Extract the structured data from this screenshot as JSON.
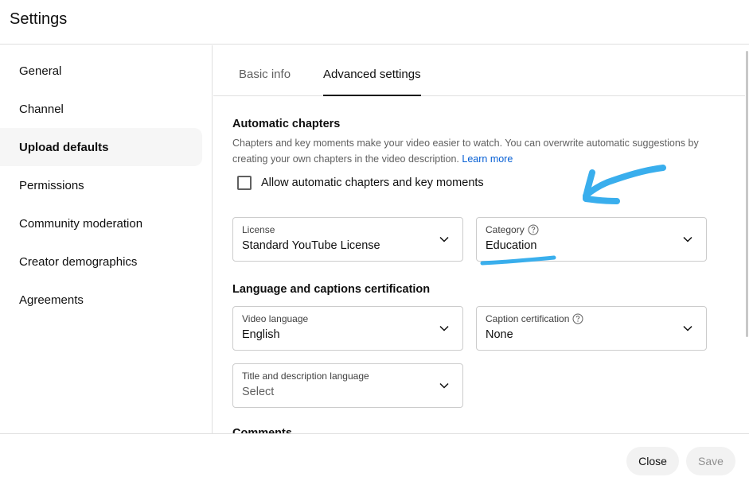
{
  "header": {
    "title": "Settings"
  },
  "sidebar": {
    "items": [
      {
        "label": "General",
        "active": false
      },
      {
        "label": "Channel",
        "active": false
      },
      {
        "label": "Upload defaults",
        "active": true
      },
      {
        "label": "Permissions",
        "active": false
      },
      {
        "label": "Community moderation",
        "active": false
      },
      {
        "label": "Creator demographics",
        "active": false
      },
      {
        "label": "Agreements",
        "active": false
      }
    ]
  },
  "tabs": [
    {
      "label": "Basic info",
      "active": false
    },
    {
      "label": "Advanced settings",
      "active": true
    }
  ],
  "auto_chapters": {
    "title": "Automatic chapters",
    "description": "Chapters and key moments make your video easier to watch. You can overwrite automatic suggestions by creating your own chapters in the video description.",
    "learn_more": "Learn more",
    "checkbox_label": "Allow automatic chapters and key moments",
    "checked": false
  },
  "license": {
    "label": "License",
    "value": "Standard YouTube License"
  },
  "category": {
    "label": "Category",
    "value": "Education"
  },
  "language_section": {
    "title": "Language and captions certification"
  },
  "video_language": {
    "label": "Video language",
    "value": "English"
  },
  "caption_certification": {
    "label": "Caption certification",
    "value": "None"
  },
  "title_desc_language": {
    "label": "Title and description language",
    "value": "Select"
  },
  "next_section": {
    "title": "Comments"
  },
  "footer": {
    "close_label": "Close",
    "save_label": "Save"
  },
  "colors": {
    "link": "#065fd4",
    "annotation": "#29a8ec",
    "active_bg": "#f6f6f6",
    "border": "#cccccc"
  },
  "icons": {
    "dropdown": "chevron-down-icon",
    "help": "help-circle-icon",
    "annotation_arrow": "arrow-annotation-icon",
    "annotation_underline": "underline-annotation-icon"
  }
}
